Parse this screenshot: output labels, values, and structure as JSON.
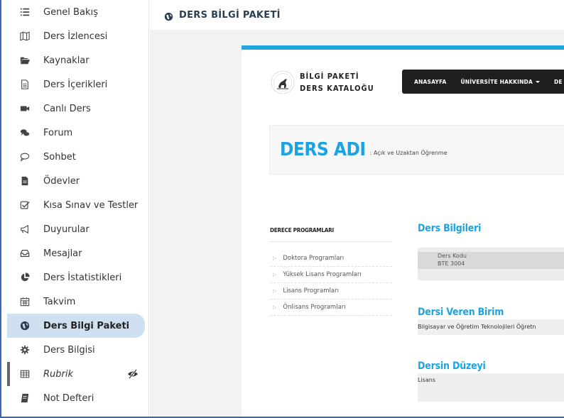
{
  "sidebar": {
    "items": [
      {
        "label": "Genel Bakış",
        "icon": "list-icon"
      },
      {
        "label": "Ders İzlencesi",
        "icon": "map-icon"
      },
      {
        "label": "Kaynaklar",
        "icon": "folder-open-icon"
      },
      {
        "label": "Ders İçerikleri",
        "icon": "document-icon"
      },
      {
        "label": "Canlı Ders",
        "icon": "video-camera-icon"
      },
      {
        "label": "Forum",
        "icon": "chat-bubbles-icon"
      },
      {
        "label": "Sohbet",
        "icon": "chat-icon"
      },
      {
        "label": "Ödevler",
        "icon": "file-icon"
      },
      {
        "label": "Kısa Sınav ve Testler",
        "icon": "checkbox-icon"
      },
      {
        "label": "Duyurular",
        "icon": "megaphone-icon"
      },
      {
        "label": "Mesajlar",
        "icon": "inbox-icon"
      },
      {
        "label": "Ders İstatistikleri",
        "icon": "pie-chart-icon"
      },
      {
        "label": "Takvim",
        "icon": "calendar-icon"
      },
      {
        "label": "Ders Bilgi Paketi",
        "icon": "globe-icon"
      },
      {
        "label": "Ders Bilgisi",
        "icon": "gear-icon"
      },
      {
        "label": "Rubrik",
        "icon": "table-icon"
      },
      {
        "label": "Not Defteri",
        "icon": "notebook-icon"
      }
    ],
    "active_index": 13
  },
  "header": {
    "title": "DERS BİLGİ PAKETİ"
  },
  "card": {
    "logo_line1": "BİLGİ PAKETİ",
    "logo_line2": "DERS KATALOĞU",
    "nav": {
      "home": "ANASAYFA",
      "about": "ÜNİVERSİTE HAKKINDA",
      "cut": "DE"
    },
    "course_label": "DERS ADI",
    "course_name": ": Açık ve Uzaktan Öğrenme",
    "programs_heading": "DERECE PROGRAMLARI",
    "programs": [
      "Doktora Programları",
      "Yüksek Lisans Programları",
      "Lisans Programları",
      "Önlisans Programları"
    ],
    "section1_title": "Ders Bilgileri",
    "code_label": "Ders Kodu",
    "code_value": "BTE 3004",
    "section2_title": "Dersi Veren Birim",
    "section2_text": "Bilgisayar ve Öğretim Teknolojileri Öğretn",
    "section3_title": "Dersin Düzeyi",
    "section3_text": "Lisans"
  },
  "colors": {
    "accent_blue": "#1ba3e3",
    "active_bg": "#cfe0f0",
    "navbar_bg": "#1f1f1f",
    "frame_border": "#3a67b8"
  }
}
